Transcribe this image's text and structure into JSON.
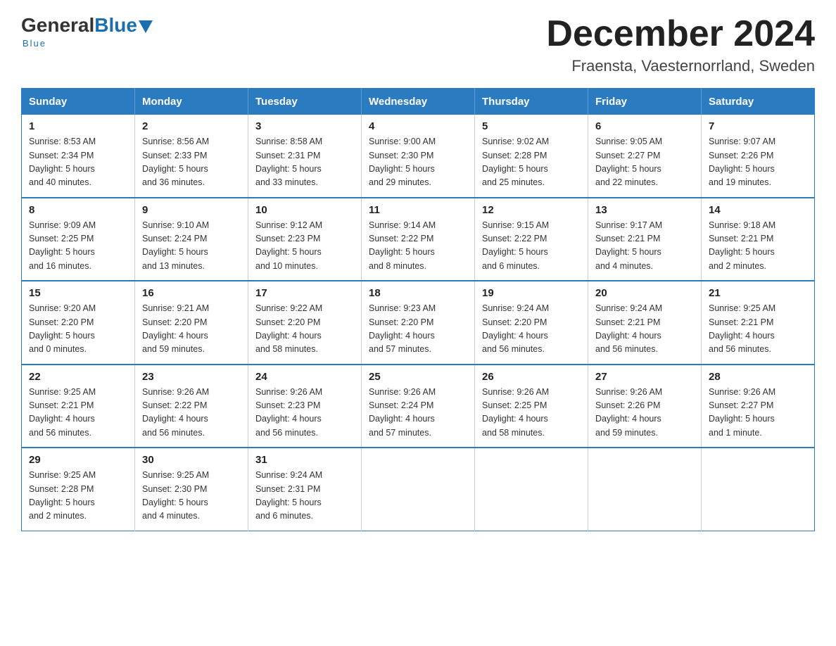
{
  "logo": {
    "general": "General",
    "blue": "Blue",
    "underline": "Blue"
  },
  "header": {
    "month_title": "December 2024",
    "location": "Fraensta, Vaesternorrland, Sweden"
  },
  "weekdays": [
    "Sunday",
    "Monday",
    "Tuesday",
    "Wednesday",
    "Thursday",
    "Friday",
    "Saturday"
  ],
  "weeks": [
    [
      {
        "day": "1",
        "info": "Sunrise: 8:53 AM\nSunset: 2:34 PM\nDaylight: 5 hours\nand 40 minutes."
      },
      {
        "day": "2",
        "info": "Sunrise: 8:56 AM\nSunset: 2:33 PM\nDaylight: 5 hours\nand 36 minutes."
      },
      {
        "day": "3",
        "info": "Sunrise: 8:58 AM\nSunset: 2:31 PM\nDaylight: 5 hours\nand 33 minutes."
      },
      {
        "day": "4",
        "info": "Sunrise: 9:00 AM\nSunset: 2:30 PM\nDaylight: 5 hours\nand 29 minutes."
      },
      {
        "day": "5",
        "info": "Sunrise: 9:02 AM\nSunset: 2:28 PM\nDaylight: 5 hours\nand 25 minutes."
      },
      {
        "day": "6",
        "info": "Sunrise: 9:05 AM\nSunset: 2:27 PM\nDaylight: 5 hours\nand 22 minutes."
      },
      {
        "day": "7",
        "info": "Sunrise: 9:07 AM\nSunset: 2:26 PM\nDaylight: 5 hours\nand 19 minutes."
      }
    ],
    [
      {
        "day": "8",
        "info": "Sunrise: 9:09 AM\nSunset: 2:25 PM\nDaylight: 5 hours\nand 16 minutes."
      },
      {
        "day": "9",
        "info": "Sunrise: 9:10 AM\nSunset: 2:24 PM\nDaylight: 5 hours\nand 13 minutes."
      },
      {
        "day": "10",
        "info": "Sunrise: 9:12 AM\nSunset: 2:23 PM\nDaylight: 5 hours\nand 10 minutes."
      },
      {
        "day": "11",
        "info": "Sunrise: 9:14 AM\nSunset: 2:22 PM\nDaylight: 5 hours\nand 8 minutes."
      },
      {
        "day": "12",
        "info": "Sunrise: 9:15 AM\nSunset: 2:22 PM\nDaylight: 5 hours\nand 6 minutes."
      },
      {
        "day": "13",
        "info": "Sunrise: 9:17 AM\nSunset: 2:21 PM\nDaylight: 5 hours\nand 4 minutes."
      },
      {
        "day": "14",
        "info": "Sunrise: 9:18 AM\nSunset: 2:21 PM\nDaylight: 5 hours\nand 2 minutes."
      }
    ],
    [
      {
        "day": "15",
        "info": "Sunrise: 9:20 AM\nSunset: 2:20 PM\nDaylight: 5 hours\nand 0 minutes."
      },
      {
        "day": "16",
        "info": "Sunrise: 9:21 AM\nSunset: 2:20 PM\nDaylight: 4 hours\nand 59 minutes."
      },
      {
        "day": "17",
        "info": "Sunrise: 9:22 AM\nSunset: 2:20 PM\nDaylight: 4 hours\nand 58 minutes."
      },
      {
        "day": "18",
        "info": "Sunrise: 9:23 AM\nSunset: 2:20 PM\nDaylight: 4 hours\nand 57 minutes."
      },
      {
        "day": "19",
        "info": "Sunrise: 9:24 AM\nSunset: 2:20 PM\nDaylight: 4 hours\nand 56 minutes."
      },
      {
        "day": "20",
        "info": "Sunrise: 9:24 AM\nSunset: 2:21 PM\nDaylight: 4 hours\nand 56 minutes."
      },
      {
        "day": "21",
        "info": "Sunrise: 9:25 AM\nSunset: 2:21 PM\nDaylight: 4 hours\nand 56 minutes."
      }
    ],
    [
      {
        "day": "22",
        "info": "Sunrise: 9:25 AM\nSunset: 2:21 PM\nDaylight: 4 hours\nand 56 minutes."
      },
      {
        "day": "23",
        "info": "Sunrise: 9:26 AM\nSunset: 2:22 PM\nDaylight: 4 hours\nand 56 minutes."
      },
      {
        "day": "24",
        "info": "Sunrise: 9:26 AM\nSunset: 2:23 PM\nDaylight: 4 hours\nand 56 minutes."
      },
      {
        "day": "25",
        "info": "Sunrise: 9:26 AM\nSunset: 2:24 PM\nDaylight: 4 hours\nand 57 minutes."
      },
      {
        "day": "26",
        "info": "Sunrise: 9:26 AM\nSunset: 2:25 PM\nDaylight: 4 hours\nand 58 minutes."
      },
      {
        "day": "27",
        "info": "Sunrise: 9:26 AM\nSunset: 2:26 PM\nDaylight: 4 hours\nand 59 minutes."
      },
      {
        "day": "28",
        "info": "Sunrise: 9:26 AM\nSunset: 2:27 PM\nDaylight: 5 hours\nand 1 minute."
      }
    ],
    [
      {
        "day": "29",
        "info": "Sunrise: 9:25 AM\nSunset: 2:28 PM\nDaylight: 5 hours\nand 2 minutes."
      },
      {
        "day": "30",
        "info": "Sunrise: 9:25 AM\nSunset: 2:30 PM\nDaylight: 5 hours\nand 4 minutes."
      },
      {
        "day": "31",
        "info": "Sunrise: 9:24 AM\nSunset: 2:31 PM\nDaylight: 5 hours\nand 6 minutes."
      },
      {
        "day": "",
        "info": ""
      },
      {
        "day": "",
        "info": ""
      },
      {
        "day": "",
        "info": ""
      },
      {
        "day": "",
        "info": ""
      }
    ]
  ]
}
